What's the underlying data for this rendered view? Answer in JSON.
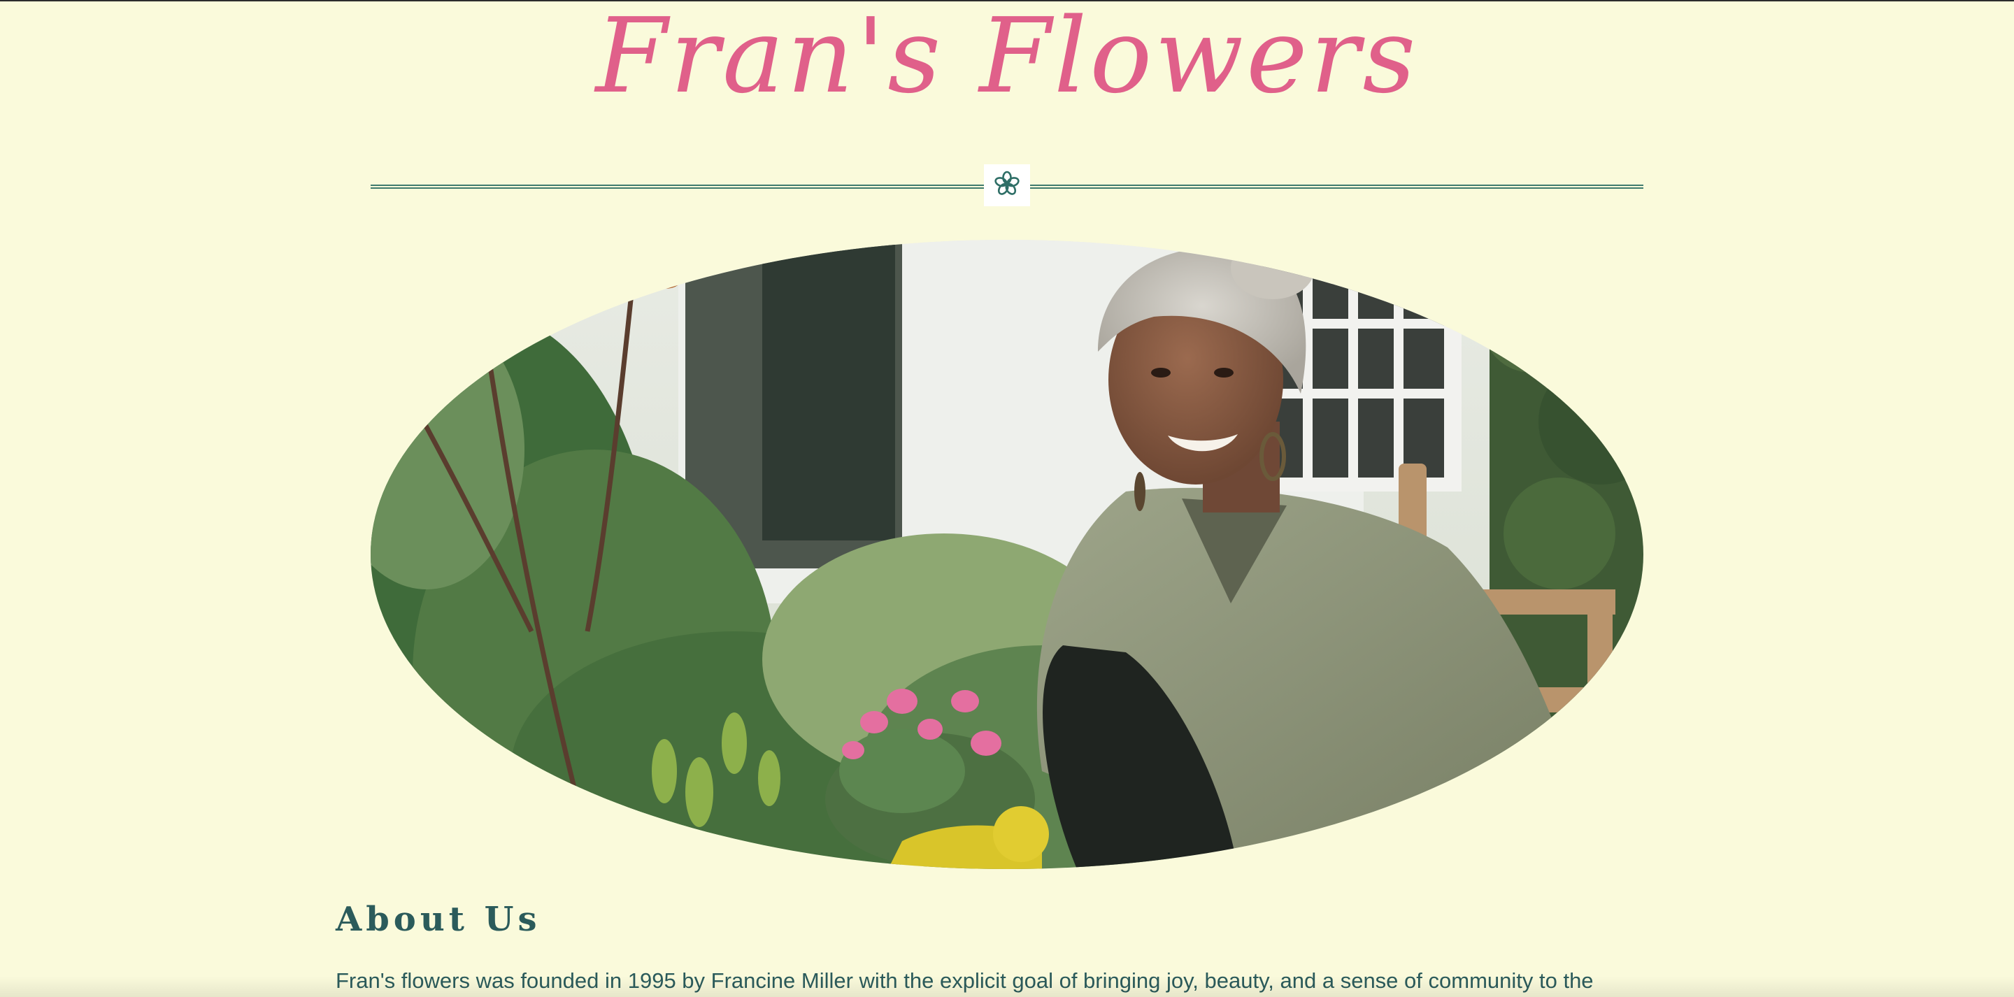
{
  "site": {
    "title": "Fran's Flowers"
  },
  "divider": {
    "icon": "flower-icon"
  },
  "hero": {
    "image": "woman-gardening-photo"
  },
  "about": {
    "heading": "About Us",
    "text": "Fran's flowers was founded in 1995 by Francine Miller with the explicit goal of bringing joy, beauty, and a sense of community to the"
  },
  "colors": {
    "background": "#fafadb",
    "title": "#e0608a",
    "accent": "#3f7b6e",
    "text": "#2b5b5b"
  }
}
